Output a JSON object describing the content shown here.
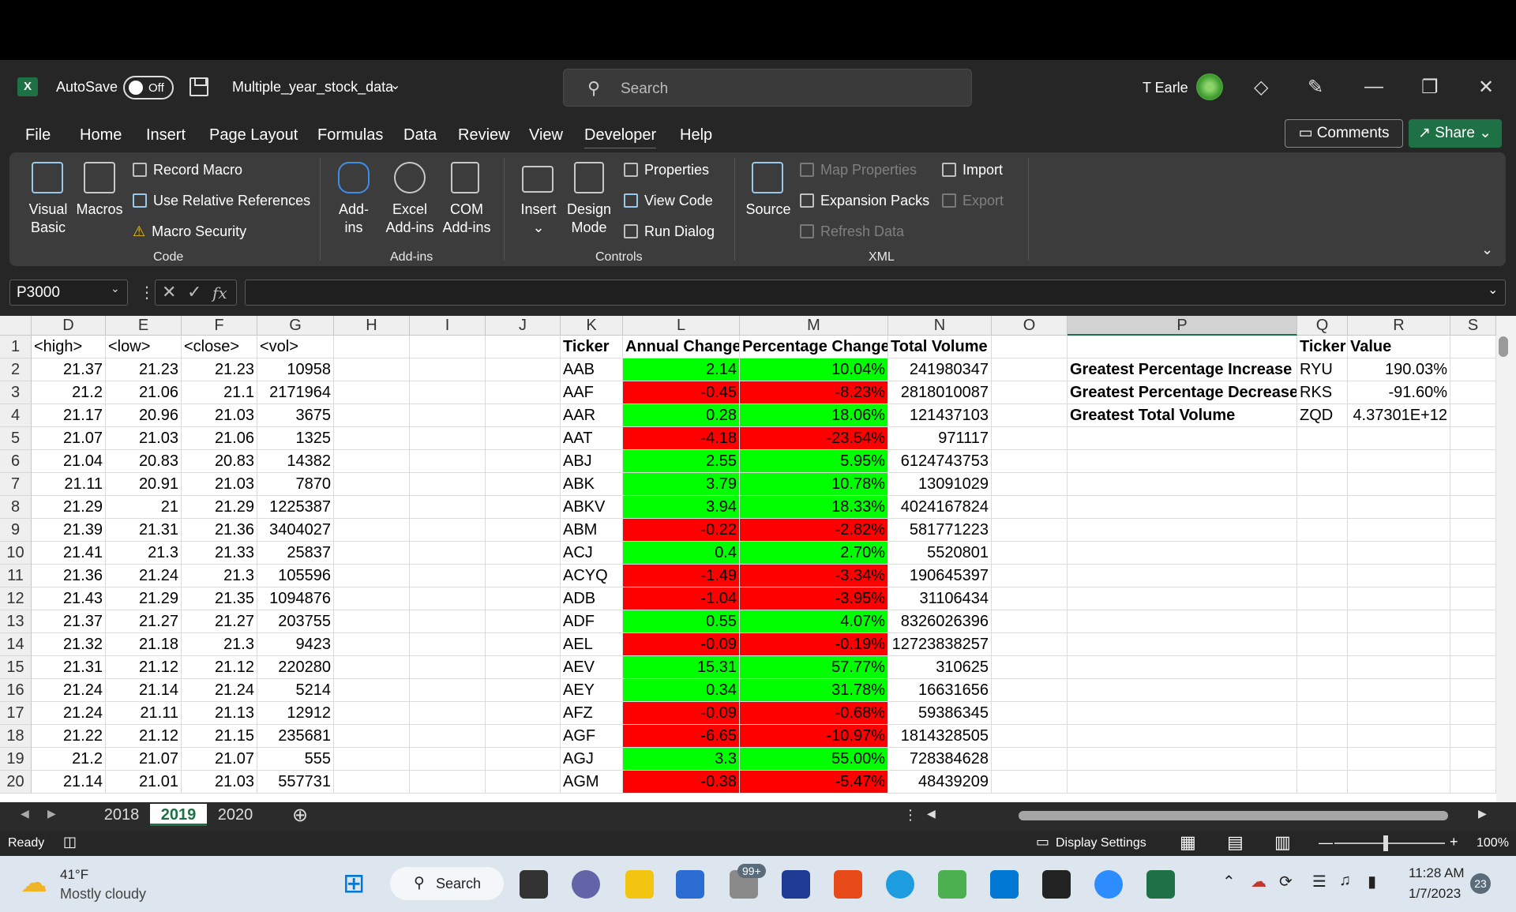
{
  "app": {
    "logo_letter": "X",
    "autosave_label": "AutoSave",
    "autosave_state": "Off",
    "file_name": "Multiple_year_stock_data",
    "search_placeholder": "Search",
    "user_name": "T Earle"
  },
  "ribbon_tabs": [
    "File",
    "Home",
    "Insert",
    "Page Layout",
    "Formulas",
    "Data",
    "Review",
    "View",
    "Developer",
    "Help"
  ],
  "active_tab": "Developer",
  "actions": {
    "comments": "Comments",
    "share": "Share"
  },
  "ribbon": {
    "code": {
      "visual_basic": [
        "Visual",
        "Basic"
      ],
      "macros": "Macros",
      "record_macro": "Record Macro",
      "use_relative": "Use Relative References",
      "macro_security": "Macro Security",
      "label": "Code"
    },
    "addins": {
      "addins": [
        "Add-",
        "ins"
      ],
      "excel_addins": [
        "Excel",
        "Add-ins"
      ],
      "com_addins": [
        "COM",
        "Add-ins"
      ],
      "label": "Add-ins"
    },
    "controls": {
      "insert": "Insert",
      "design_mode": [
        "Design",
        "Mode"
      ],
      "properties": "Properties",
      "view_code": "View Code",
      "run_dialog": "Run Dialog",
      "label": "Controls"
    },
    "xml": {
      "source": "Source",
      "map_properties": "Map Properties",
      "expansion_packs": "Expansion Packs",
      "refresh_data": "Refresh Data",
      "import": "Import",
      "export": "Export",
      "label": "XML"
    }
  },
  "formula_bar": {
    "name_box": "P3000",
    "fx": "fx",
    "formula": ""
  },
  "columns": [
    "D",
    "E",
    "F",
    "G",
    "H",
    "I",
    "J",
    "K",
    "L",
    "M",
    "N",
    "O",
    "P",
    "Q",
    "R",
    "S"
  ],
  "selected_column": "P",
  "header_row": {
    "D": "<high>",
    "E": "<low>",
    "F": "<close>",
    "G": "<vol>",
    "K": "Ticker",
    "L": "Annual Change",
    "M": "Percentage Change",
    "N": "Total Volume",
    "Q": "Ticker",
    "R": "Value"
  },
  "rows": [
    {
      "n": "2",
      "D": "21.37",
      "E": "21.23",
      "F": "21.23",
      "G": "10958",
      "K": "AAB",
      "L": "2.14",
      "M": "10.04%",
      "N": "241980347",
      "up": true
    },
    {
      "n": "3",
      "D": "21.2",
      "E": "21.06",
      "F": "21.1",
      "G": "2171964",
      "K": "AAF",
      "L": "-0.45",
      "M": "-8.23%",
      "N": "2818010087",
      "up": false
    },
    {
      "n": "4",
      "D": "21.17",
      "E": "20.96",
      "F": "21.03",
      "G": "3675",
      "K": "AAR",
      "L": "0.28",
      "M": "18.06%",
      "N": "121437103",
      "up": true
    },
    {
      "n": "5",
      "D": "21.07",
      "E": "21.03",
      "F": "21.06",
      "G": "1325",
      "K": "AAT",
      "L": "-4.18",
      "M": "-23.54%",
      "N": "971117",
      "up": false
    },
    {
      "n": "6",
      "D": "21.04",
      "E": "20.83",
      "F": "20.83",
      "G": "14382",
      "K": "ABJ",
      "L": "2.55",
      "M": "5.95%",
      "N": "6124743753",
      "up": true
    },
    {
      "n": "7",
      "D": "21.11",
      "E": "20.91",
      "F": "21.03",
      "G": "7870",
      "K": "ABK",
      "L": "3.79",
      "M": "10.78%",
      "N": "13091029",
      "up": true
    },
    {
      "n": "8",
      "D": "21.29",
      "E": "21",
      "F": "21.29",
      "G": "1225387",
      "K": "ABKV",
      "L": "3.94",
      "M": "18.33%",
      "N": "4024167824",
      "up": true
    },
    {
      "n": "9",
      "D": "21.39",
      "E": "21.31",
      "F": "21.36",
      "G": "3404027",
      "K": "ABM",
      "L": "-0.22",
      "M": "-2.82%",
      "N": "581771223",
      "up": false
    },
    {
      "n": "10",
      "D": "21.41",
      "E": "21.3",
      "F": "21.33",
      "G": "25837",
      "K": "ACJ",
      "L": "0.4",
      "M": "2.70%",
      "N": "5520801",
      "up": true
    },
    {
      "n": "11",
      "D": "21.36",
      "E": "21.24",
      "F": "21.3",
      "G": "105596",
      "K": "ACYQ",
      "L": "-1.49",
      "M": "-3.34%",
      "N": "190645397",
      "up": false
    },
    {
      "n": "12",
      "D": "21.43",
      "E": "21.29",
      "F": "21.35",
      "G": "1094876",
      "K": "ADB",
      "L": "-1.04",
      "M": "-3.95%",
      "N": "31106434",
      "up": false
    },
    {
      "n": "13",
      "D": "21.37",
      "E": "21.27",
      "F": "21.27",
      "G": "203755",
      "K": "ADF",
      "L": "0.55",
      "M": "4.07%",
      "N": "8326026396",
      "up": true
    },
    {
      "n": "14",
      "D": "21.32",
      "E": "21.18",
      "F": "21.3",
      "G": "9423",
      "K": "AEL",
      "L": "-0.09",
      "M": "-0.19%",
      "N": "12723838257",
      "up": false
    },
    {
      "n": "15",
      "D": "21.31",
      "E": "21.12",
      "F": "21.12",
      "G": "220280",
      "K": "AEV",
      "L": "15.31",
      "M": "57.77%",
      "N": "310625",
      "up": true
    },
    {
      "n": "16",
      "D": "21.24",
      "E": "21.14",
      "F": "21.24",
      "G": "5214",
      "K": "AEY",
      "L": "0.34",
      "M": "31.78%",
      "N": "16631656",
      "up": true
    },
    {
      "n": "17",
      "D": "21.24",
      "E": "21.11",
      "F": "21.13",
      "G": "12912",
      "K": "AFZ",
      "L": "-0.09",
      "M": "-0.68%",
      "N": "59386345",
      "up": false
    },
    {
      "n": "18",
      "D": "21.22",
      "E": "21.12",
      "F": "21.15",
      "G": "235681",
      "K": "AGF",
      "L": "-6.65",
      "M": "-10.97%",
      "N": "1814328505",
      "up": false
    },
    {
      "n": "19",
      "D": "21.2",
      "E": "21.07",
      "F": "21.07",
      "G": "555",
      "K": "AGJ",
      "L": "3.3",
      "M": "55.00%",
      "N": "728384628",
      "up": true
    },
    {
      "n": "20",
      "D": "21.14",
      "E": "21.01",
      "F": "21.03",
      "G": "557731",
      "K": "AGM",
      "L": "-0.38",
      "M": "-5.47%",
      "N": "48439209",
      "up": false
    }
  ],
  "summary": [
    {
      "label": "Greatest Percentage Increase",
      "ticker": "RYU",
      "value": "190.03%"
    },
    {
      "label": "Greatest Percentage Decrease",
      "ticker": "RKS",
      "value": "-91.60%"
    },
    {
      "label": "Greatest Total Volume",
      "ticker": "ZQD",
      "value": "4.37301E+12"
    }
  ],
  "sheets": [
    "2018",
    "2019",
    "2020"
  ],
  "active_sheet": "2019",
  "status": {
    "ready": "Ready",
    "display_settings": "Display Settings",
    "zoom": "100%"
  },
  "taskbar": {
    "weather_temp": "41°F",
    "weather_desc": "Mostly cloudy",
    "search": "Search",
    "badge": "99+",
    "time": "11:28 AM",
    "date": "1/7/2023",
    "notif": "23"
  },
  "colors": {
    "positive": "#00ff00",
    "negative": "#ff0000",
    "excel_green": "#1e7145"
  }
}
